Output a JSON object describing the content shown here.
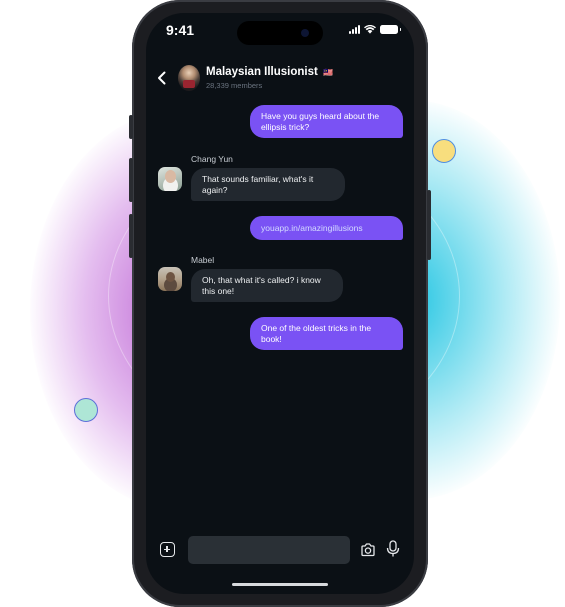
{
  "status_bar": {
    "time": "9:41"
  },
  "header": {
    "title": "Malaysian Illusionist",
    "flag": "🇲🇾",
    "subtitle": "28,339 members",
    "back_icon": "chevron-left-icon"
  },
  "messages": [
    {
      "type": "outgoing",
      "text": "Have you guys heard about the ellipsis trick?"
    },
    {
      "type": "incoming",
      "sender": "Chang Yun",
      "text": "That sounds familiar, what's it again?"
    },
    {
      "type": "outgoing",
      "text": "youapp.in/amazingillusions"
    },
    {
      "type": "incoming",
      "sender": "Mabel",
      "text": "Oh, that what it's called? i know this one!"
    },
    {
      "type": "outgoing",
      "text": "One of the oldest tricks in the book!"
    }
  ],
  "composer": {
    "input_value": "",
    "placeholder": "",
    "icons": [
      "plus-icon",
      "camera-icon",
      "microphone-icon"
    ]
  },
  "colors": {
    "outgoing_bubble": "#7a52f4",
    "incoming_bubble": "#22282f",
    "screen_background": "#0b1015"
  }
}
